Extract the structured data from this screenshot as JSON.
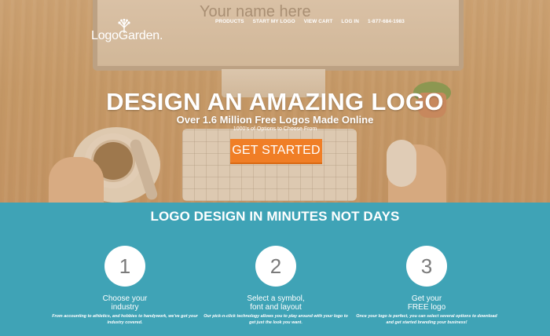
{
  "brand": {
    "logo_text": "LogoGarden."
  },
  "nav": {
    "products": "PRODUCTS",
    "start_my_logo": "START MY LOGO",
    "view_cart": "VIEW CART",
    "log_in": "LOG IN",
    "phone": "1-877-684-1983"
  },
  "hero": {
    "monitor_text": "Your name here",
    "title": "DESIGN AN AMAZING LOGO",
    "subtitle": "Over 1.6 Million Free Logos Made Online",
    "note": "1000's of Options to Choose From",
    "cta_label": "GET STARTED",
    "cta_color": "#f07e26"
  },
  "steps_section": {
    "heading": "LOGO DESIGN IN MINUTES NOT DAYS",
    "background_color": "#3fa3b6",
    "steps": [
      {
        "number": "1",
        "title_line1": "Choose your",
        "title_line2": "industry",
        "description": "From accounting to athletics, and hobbies to handywork, we've got your industry covered."
      },
      {
        "number": "2",
        "title_line1": "Select a symbol,",
        "title_line2": "font and layout",
        "description": "Our pick-n-click technology allows you to play around with your logo to get just the look you want."
      },
      {
        "number": "3",
        "title_line1": "Get your",
        "title_line2": "FREE logo",
        "description": "Once your logo is perfect, you can select several options to download and get started branding your business!"
      }
    ]
  }
}
